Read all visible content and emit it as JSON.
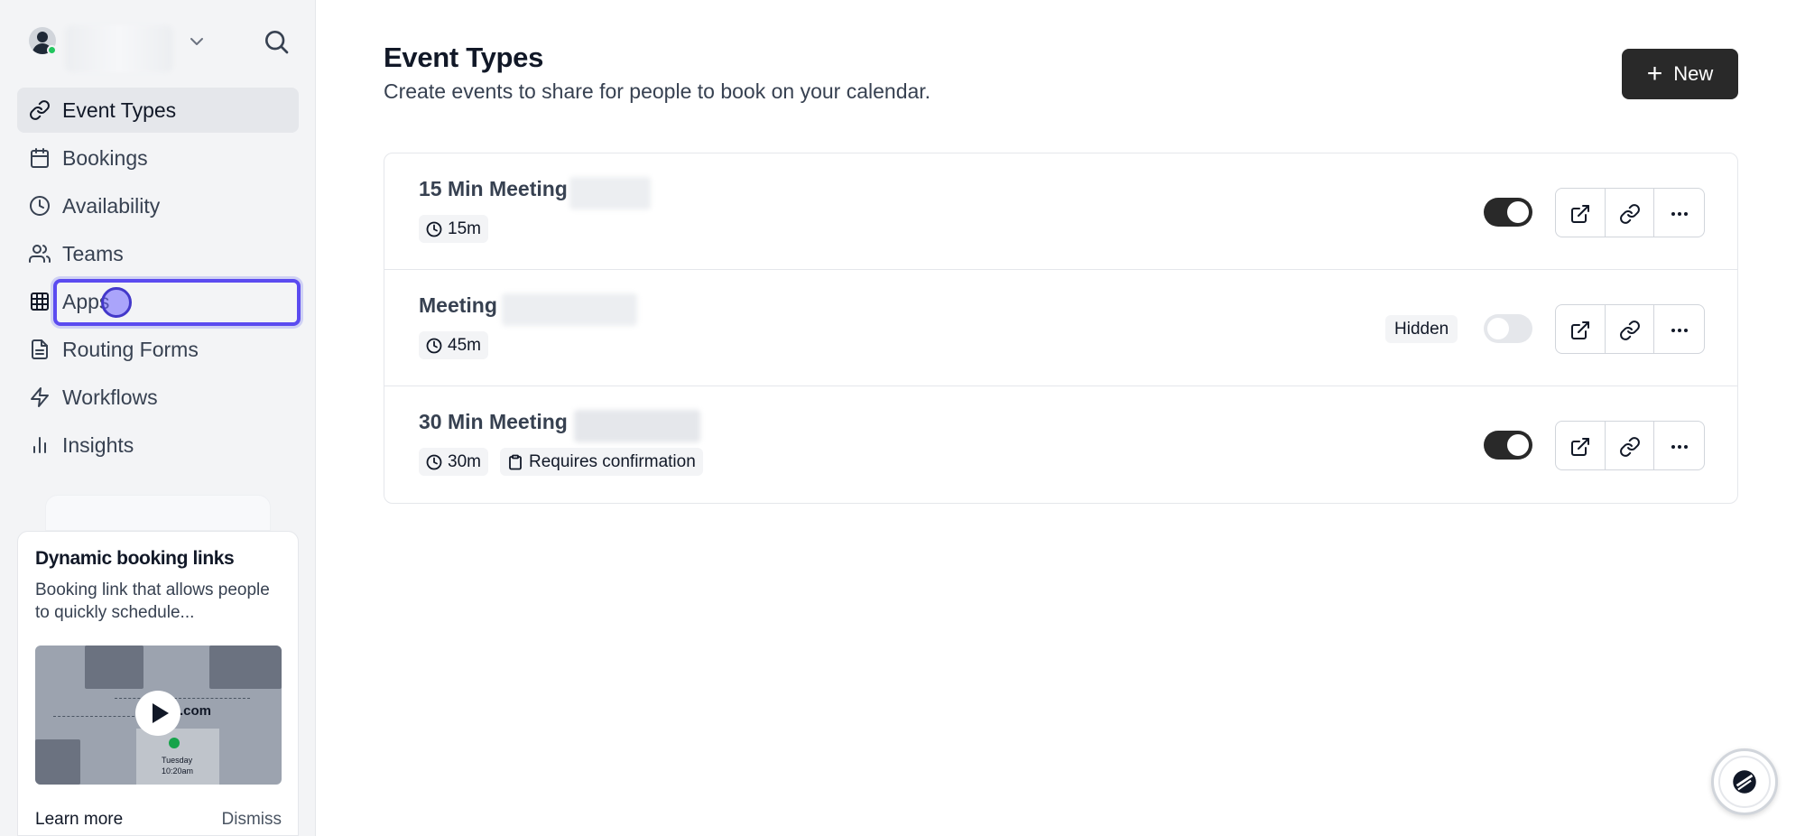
{
  "sidebar": {
    "items": [
      {
        "label": "Event Types",
        "icon": "link-icon",
        "active": true
      },
      {
        "label": "Bookings",
        "icon": "calendar-icon"
      },
      {
        "label": "Availability",
        "icon": "clock-icon"
      },
      {
        "label": "Teams",
        "icon": "users-icon"
      },
      {
        "label": "Apps",
        "icon": "grid-icon"
      },
      {
        "label": "Routing Forms",
        "icon": "file-text-icon"
      },
      {
        "label": "Workflows",
        "icon": "zap-icon"
      },
      {
        "label": "Insights",
        "icon": "bar-chart-icon"
      }
    ],
    "promo": {
      "title": "Dynamic booking links",
      "description": "Booking link that allows people to quickly schedule...",
      "video_text": ".com",
      "video_day": "Tuesday",
      "video_time": "10:20am",
      "learn_more": "Learn more",
      "dismiss": "Dismiss"
    }
  },
  "main": {
    "title": "Event Types",
    "subtitle": "Create events to share for people to book on your calendar.",
    "new_button": "New",
    "events": [
      {
        "title": "15 Min Meeting",
        "duration": "15m",
        "enabled": true
      },
      {
        "title": "Meeting",
        "duration": "45m",
        "hidden_label": "Hidden",
        "enabled": false
      },
      {
        "title": "30 Min Meeting",
        "duration": "30m",
        "extra_badge": "Requires confirmation",
        "enabled": true
      }
    ]
  },
  "colors": {
    "primary": "#292929",
    "focus_ring": "#5b4bf0",
    "online": "#22c55e"
  }
}
